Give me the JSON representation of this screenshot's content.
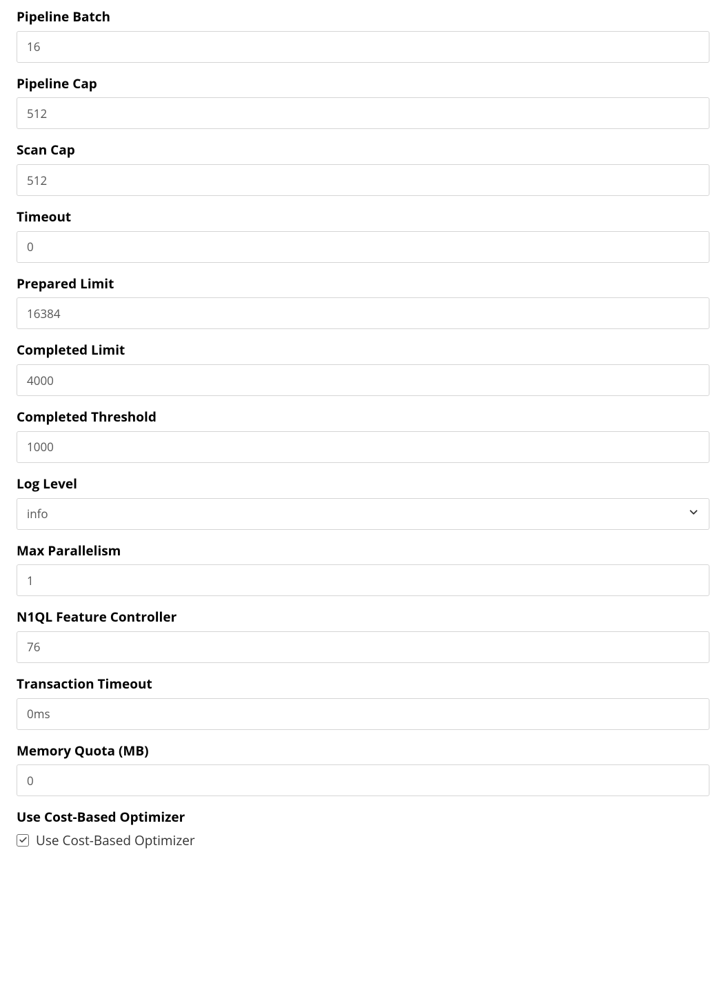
{
  "form": {
    "pipeline_batch": {
      "label": "Pipeline Batch",
      "value": "16"
    },
    "pipeline_cap": {
      "label": "Pipeline Cap",
      "value": "512"
    },
    "scan_cap": {
      "label": "Scan Cap",
      "value": "512"
    },
    "timeout": {
      "label": "Timeout",
      "value": "0"
    },
    "prepared_limit": {
      "label": "Prepared Limit",
      "value": "16384"
    },
    "completed_limit": {
      "label": "Completed Limit",
      "value": "4000"
    },
    "completed_threshold": {
      "label": "Completed Threshold",
      "value": "1000"
    },
    "log_level": {
      "label": "Log Level",
      "value": "info"
    },
    "max_parallelism": {
      "label": "Max Parallelism",
      "value": "1"
    },
    "n1ql_feature": {
      "label": "N1QL Feature Controller",
      "value": "76"
    },
    "txn_timeout": {
      "label": "Transaction Timeout",
      "value": "0ms"
    },
    "memory_quota": {
      "label": "Memory Quota (MB)",
      "value": "0"
    },
    "use_cbo": {
      "label": "Use Cost-Based Optimizer",
      "checkbox_label": "Use Cost-Based Optimizer",
      "checked": true
    }
  }
}
